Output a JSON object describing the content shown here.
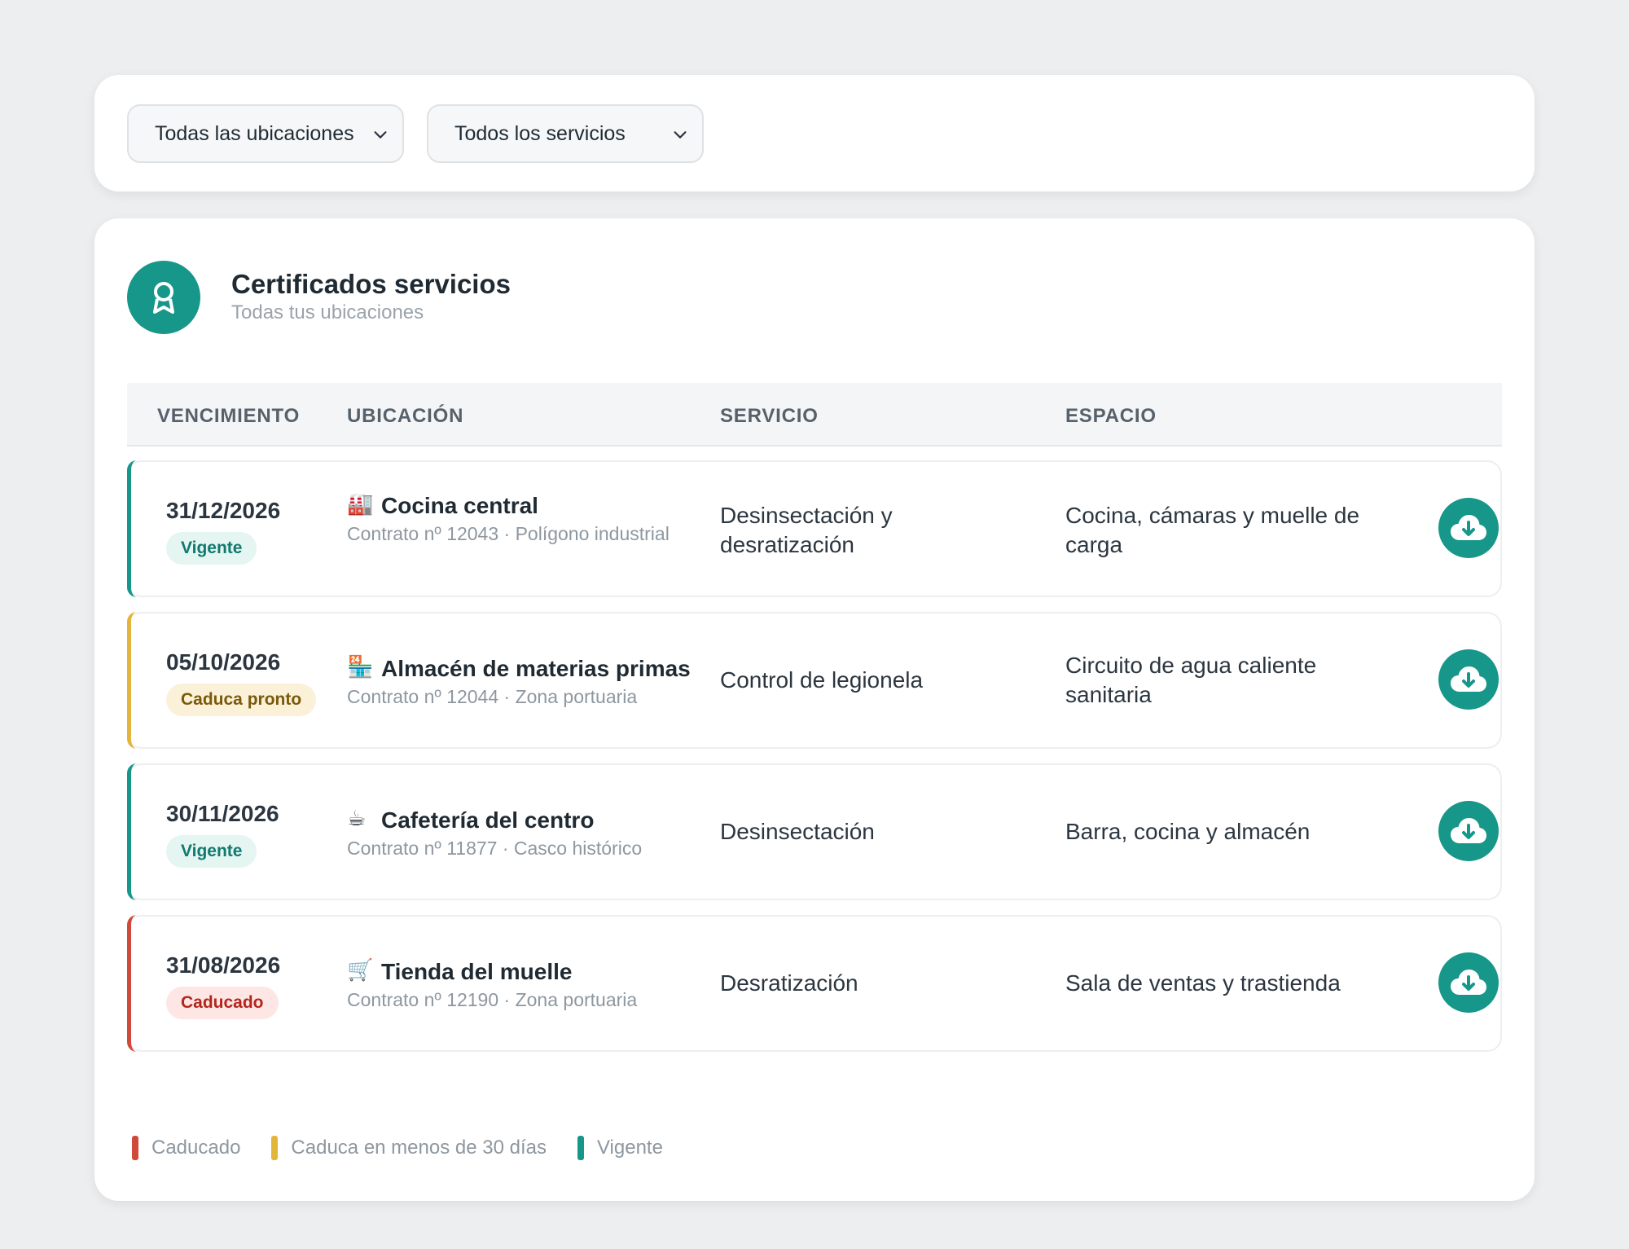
{
  "filters": {
    "locations": {
      "selected": "Todas las ubicaciones",
      "icon": "chevron-down-icon"
    },
    "services": {
      "selected": "Todos los servicios",
      "icon": "chevron-down-icon"
    }
  },
  "card": {
    "icon": "certificate-award-icon",
    "title": "Certificados servicios",
    "subtitle": "Todas tus ubicaciones"
  },
  "table": {
    "headers": {
      "expiry": "VENCIMIENTO",
      "location": "UBICACIÓN",
      "service": "SERVICIO",
      "space": "ESPACIO"
    },
    "rows": [
      {
        "date": "31/12/2026",
        "status": "Vigente",
        "status_color": "#16978a",
        "location_icon": "🏭",
        "location": "Cocina central",
        "contract": "Contrato nº 12043 · Polígono industrial",
        "service": "Desinsectación y desratización",
        "space": "Cocina, cámaras y muelle de carga",
        "download_icon": "cloud-download-icon"
      },
      {
        "date": "05/10/2026",
        "status": "Caduca pronto",
        "status_color": "#e3b53a",
        "location_icon": "🏪",
        "location": "Almacén de materias primas",
        "contract": "Contrato nº 12044 · Zona portuaria",
        "service": "Control de legionela",
        "space": "Circuito de agua caliente sanitaria",
        "download_icon": "cloud-download-icon"
      },
      {
        "date": "30/11/2026",
        "status": "Vigente",
        "status_color": "#16978a",
        "location_icon": "☕",
        "location": "Cafetería del centro",
        "contract": "Contrato nº 11877 · Casco histórico",
        "service": "Desinsectación",
        "space": "Barra, cocina y almacén",
        "download_icon": "cloud-download-icon"
      },
      {
        "date": "31/08/2026",
        "status": "Caducado",
        "status_color": "#d04a3c",
        "location_icon": "🛒",
        "location": "Tienda del muelle",
        "contract": "Contrato nº 12190 · Zona portuaria",
        "service": "Desratización",
        "space": "Sala de ventas y trastienda",
        "download_icon": "cloud-download-icon"
      }
    ]
  },
  "legend": [
    {
      "label": "Caducado",
      "color": "#d04a3c"
    },
    {
      "label": "Caduca en menos de 30 días",
      "color": "#e3b53a"
    },
    {
      "label": "Vigente",
      "color": "#16978a"
    }
  ]
}
